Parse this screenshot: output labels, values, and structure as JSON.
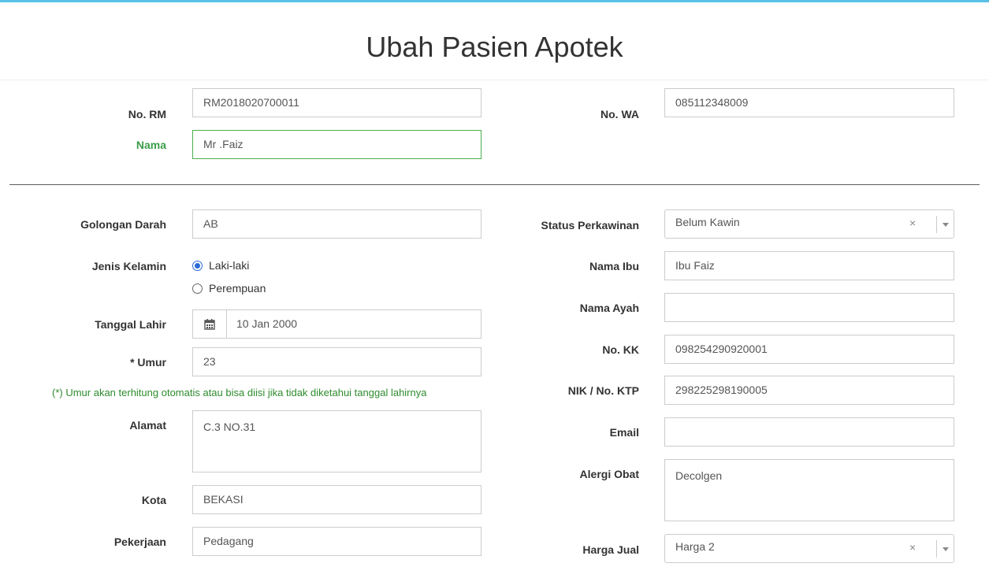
{
  "page": {
    "title": "Ubah Pasien Apotek"
  },
  "top": {
    "no_rm": {
      "label": "No. RM",
      "value": "RM2018020700011"
    },
    "no_wa": {
      "label": "No. WA",
      "value": "085112348009"
    },
    "nama": {
      "label": "Nama",
      "value": "Mr .Faiz"
    }
  },
  "left": {
    "golongan_darah": {
      "label": "Golongan Darah",
      "value": "AB"
    },
    "jenis_kelamin": {
      "label": "Jenis Kelamin",
      "options": [
        "Laki-laki",
        "Perempuan"
      ],
      "selected": "Laki-laki"
    },
    "tanggal_lahir": {
      "label": "Tanggal Lahir",
      "value": "10 Jan 2000",
      "icon": "calendar-icon"
    },
    "umur": {
      "label": "* Umur",
      "value": "23"
    },
    "umur_hint": "(*) Umur akan terhitung otomatis atau bisa diisi jika tidak diketahui tanggal lahirnya",
    "alamat": {
      "label": "Alamat",
      "value": "C.3 NO.31"
    },
    "kota": {
      "label": "Kota",
      "value": "BEKASI"
    },
    "pekerjaan": {
      "label": "Pekerjaan",
      "value": "Pedagang"
    }
  },
  "right": {
    "status_perkawinan": {
      "label": "Status Perkawinan",
      "value": "Belum Kawin",
      "clear": "×"
    },
    "nama_ibu": {
      "label": "Nama Ibu",
      "value": "Ibu Faiz"
    },
    "nama_ayah": {
      "label": "Nama Ayah",
      "value": ""
    },
    "no_kk": {
      "label": "No. KK",
      "value": "098254290920001"
    },
    "nik": {
      "label": "NIK / No. KTP",
      "value": "298225298190005"
    },
    "email": {
      "label": "Email",
      "value": ""
    },
    "alergi_obat": {
      "label": "Alergi Obat",
      "value": "Decolgen"
    },
    "harga_jual": {
      "label": "Harga Jual",
      "value": "Harga 2",
      "clear": "×"
    }
  },
  "colors": {
    "accent": "#5bc0e8",
    "valid": "#3c9d4a",
    "hint": "#2e8b2e",
    "radio": "#2a6bd6"
  }
}
